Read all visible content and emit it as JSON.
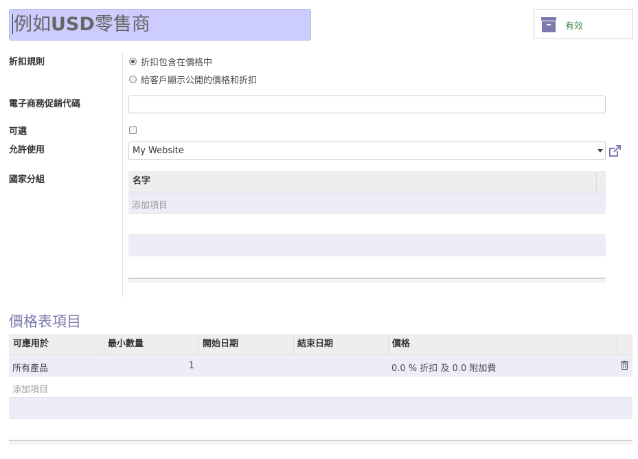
{
  "header": {
    "name_prefix": "例如",
    "name_bold": "USD",
    "name_suffix": "零售商",
    "active_label": "有效"
  },
  "form": {
    "discount_policy_label": "折扣規則",
    "discount_options": [
      {
        "label": "折扣包含在價格中",
        "selected": true
      },
      {
        "label": "給客戶顯示公開的價格和折扣",
        "selected": false
      }
    ],
    "promo_code_label": "電子商務促銷代碼",
    "promo_code_value": "",
    "selectable_label": "可選",
    "selectable_checked": false,
    "allowed_label": "允許使用",
    "website_value": "My Website",
    "country_groups_label": "國家分組",
    "country_table": {
      "column": "名字",
      "add_item": "添加項目"
    }
  },
  "pricelist_items": {
    "title": "價格表項目",
    "columns": [
      "可應用於",
      "最小數量",
      "開始日期",
      "結束日期",
      "價格"
    ],
    "rows": [
      {
        "applied_on": "所有產品",
        "min_qty": "1",
        "start": "",
        "end": "",
        "price": "0.0 % 折扣 及 0.0 附加費"
      }
    ],
    "add_item": "添加項目"
  },
  "colors": {
    "name_field_bg": "#ccccfe",
    "active_green": "#4b8a4e",
    "section_title": "#7c7bad",
    "row_stripe": "#ededf7"
  }
}
